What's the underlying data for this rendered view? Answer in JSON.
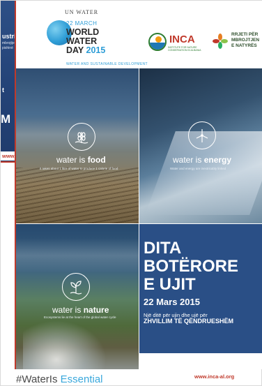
{
  "back_card": {
    "heading": "ustri",
    "body": "mbrojtjen dhe e ujë si një pishinë",
    "text_mid": "t",
    "text_big": "M",
    "url": "www.inca-al.org"
  },
  "header": {
    "un_label": "UN WATER",
    "date": "22 MARCH",
    "wwd_line1": "WORLD",
    "wwd_line2": "WATER",
    "wwd_line3": "DAY",
    "wwd_year": "2015",
    "subline": "WATER AND SUSTAINABLE DEVELOPMENT",
    "inca_name": "INCA",
    "inca_sub": "INSTITUTE FOR NATURE CONSERVATION IN ALBANIA",
    "rmn_line1": "RRJETI PËR",
    "rmn_line2": "MBROJTJEN",
    "rmn_line3": "E NATYRËS"
  },
  "tiles": {
    "food": {
      "prefix": "water is ",
      "word": "food",
      "caption": "It takes about 1 litre of water to produce 1 calorie of food"
    },
    "energy": {
      "prefix": "water is ",
      "word": "energy",
      "caption": "Water and energy are inextricably linked"
    },
    "nature": {
      "prefix": "water is ",
      "word": "nature",
      "caption": "Ecosystems lie at the heart of the global water cycle"
    }
  },
  "headline": {
    "line1": "DITA",
    "line2": "BOTËRORE",
    "line3": "E UJIT",
    "date": "22 Mars 2015",
    "tag1": "Një ditë për ujin dhe ujë për",
    "tag2": "ZHVILLIM TË QËNDRUESHËM"
  },
  "footer": {
    "hashtag_prefix": "#WaterIs ",
    "hashtag_accent": "Essential",
    "url": "www.inca-al.org"
  },
  "colors": {
    "accent_red": "#c0392b",
    "accent_blue": "#2e9dd6",
    "poster_blue": "#2a4f86",
    "hashtag_blue": "#3aa8dc"
  },
  "icons": [
    "un-water-logo",
    "inca-logo",
    "rmn-logo",
    "wheat-icon",
    "wind-turbine-icon",
    "sprout-icon"
  ]
}
